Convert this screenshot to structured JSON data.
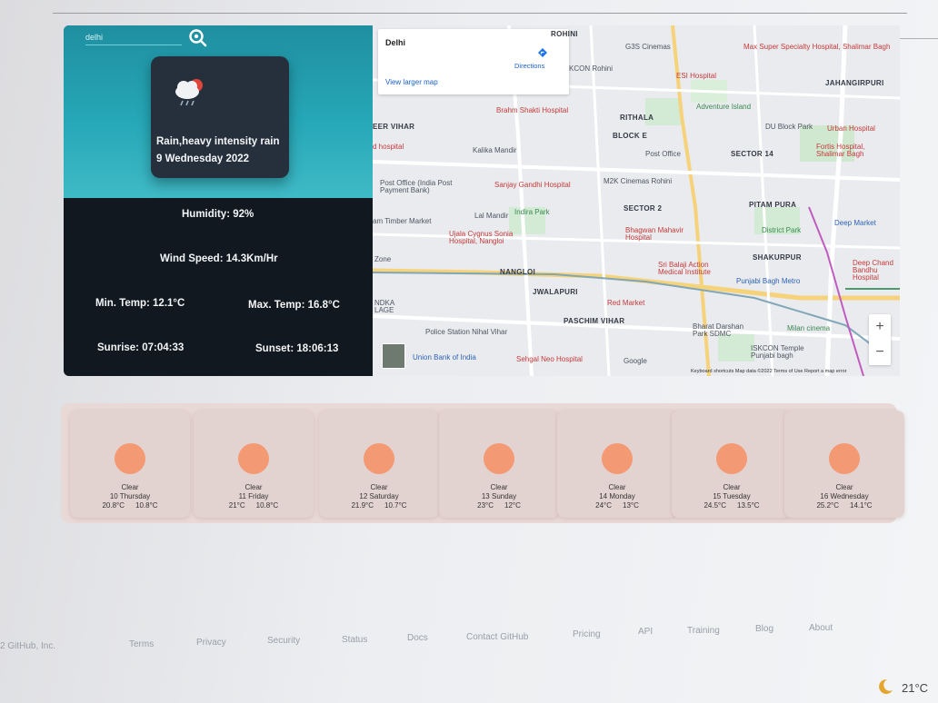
{
  "search": {
    "value": "delhi"
  },
  "current": {
    "condition": "Rain,heavy intensity rain",
    "date": "9 Wednesday 2022",
    "humidity": "Humidity: 92%",
    "wind": "Wind Speed: 14.3Km/Hr",
    "min_temp": "Min. Temp: 12.1°C",
    "max_temp": "Max. Temp: 16.8°C",
    "sunrise": "Sunrise: 07:04:33",
    "sunset": "Sunset: 18:06:13",
    "icon": "rain-cloud-icon"
  },
  "map": {
    "place": "Delhi",
    "view_larger": "View larger map",
    "directions": "Directions",
    "footer": "Keyboard shortcuts   Map data ©2022   Terms of Use   Report a map error",
    "google": "Google",
    "labels": {
      "rohini": "ROHINI",
      "g3s": "G3S Cinemas",
      "max": "Max Super Specialty Hospital, Shalimar Bagh",
      "jahangirpuri": "JAHANGIRPURI",
      "kcon": "KCON Rohini",
      "esi": "ESI Hospital",
      "adventure": "Adventure Island",
      "brahm": "Brahm Shakti Hospital",
      "rithala": "RITHALA",
      "du": "DU Block Park",
      "urban": "Urban Hospital",
      "eer": "EER VIHAR",
      "dhospital": "d hospital",
      "kalika": "Kalika Mandir",
      "block": "BLOCK E",
      "postoffice": "Post Office",
      "sector14": "SECTOR 14",
      "fortis": "Fortis Hospital, Shalimar Bagh",
      "postoffice_india": "Post Office (India Post Payment Bank)",
      "sanjay": "Sanjay Gandhi Hospital",
      "m2k": "M2K Cinemas Rohini",
      "pitampura": "PITAM PURA",
      "lalmandir": "Lal Mandir",
      "timber": "am Timber Market",
      "indira": "Indira Park",
      "sector2": "SECTOR 2",
      "deep": "Deep Market",
      "ujala": "Ujala Cygnus Sonia Hospital, Nangloi",
      "bhagwan": "Bhagwan Mahavir Hospital",
      "district": "District Park",
      "zone": "Zone",
      "nangloi": "NANGLOI",
      "srbalaji": "Sri Balaji Action Medical Institute",
      "shakurpur": "SHAKURPUR",
      "deepchand": "Deep Chand Bandhu Hospital",
      "punjabi": "Punjabi Bagh Metro",
      "jwalapuri": "JWALAPURI",
      "redmarket": "Red Market",
      "paschim": "PASCHIM VIHAR",
      "bharat": "Bharat Darshan Park SDMC",
      "milan": "Milan cinema",
      "police": "Police Station Nihal Vihar",
      "iskcon": "ISKCON Temple Punjabi bagh",
      "union": "Union Bank of India",
      "sehgal": "Sehgal Neo Hospital",
      "ndka": "NDKA LAGE"
    }
  },
  "forecast": [
    {
      "cond": "Clear",
      "date": "10 Thursday",
      "max": "20.8°C",
      "min": "10.8°C"
    },
    {
      "cond": "Clear",
      "date": "11 Friday",
      "max": "21°C",
      "min": "10.8°C"
    },
    {
      "cond": "Clear",
      "date": "12 Saturday",
      "max": "21.9°C",
      "min": "10.7°C"
    },
    {
      "cond": "Clear",
      "date": "13 Sunday",
      "max": "23°C",
      "min": "12°C"
    },
    {
      "cond": "Clear",
      "date": "14 Monday",
      "max": "24°C",
      "min": "13°C"
    },
    {
      "cond": "Clear",
      "date": "15 Tuesday",
      "max": "24.5°C",
      "min": "13.5°C"
    },
    {
      "cond": "Clear",
      "date": "16 Wednesday",
      "max": "25.2°C",
      "min": "14.1°C"
    }
  ],
  "footer": {
    "copyright": "2 GitHub, Inc.",
    "links": [
      "Terms",
      "Privacy",
      "Security",
      "Status",
      "Docs",
      "Contact GitHub",
      "Pricing",
      "API",
      "Training",
      "Blog",
      "About"
    ]
  },
  "taskbar": {
    "temp": "21°C"
  },
  "colors": {
    "panel_top": "#26a7b7",
    "panel_bottom": "#111820",
    "card": "#26303c",
    "sun": "#f39a74",
    "forecast_bg": "#e8d8d6"
  }
}
